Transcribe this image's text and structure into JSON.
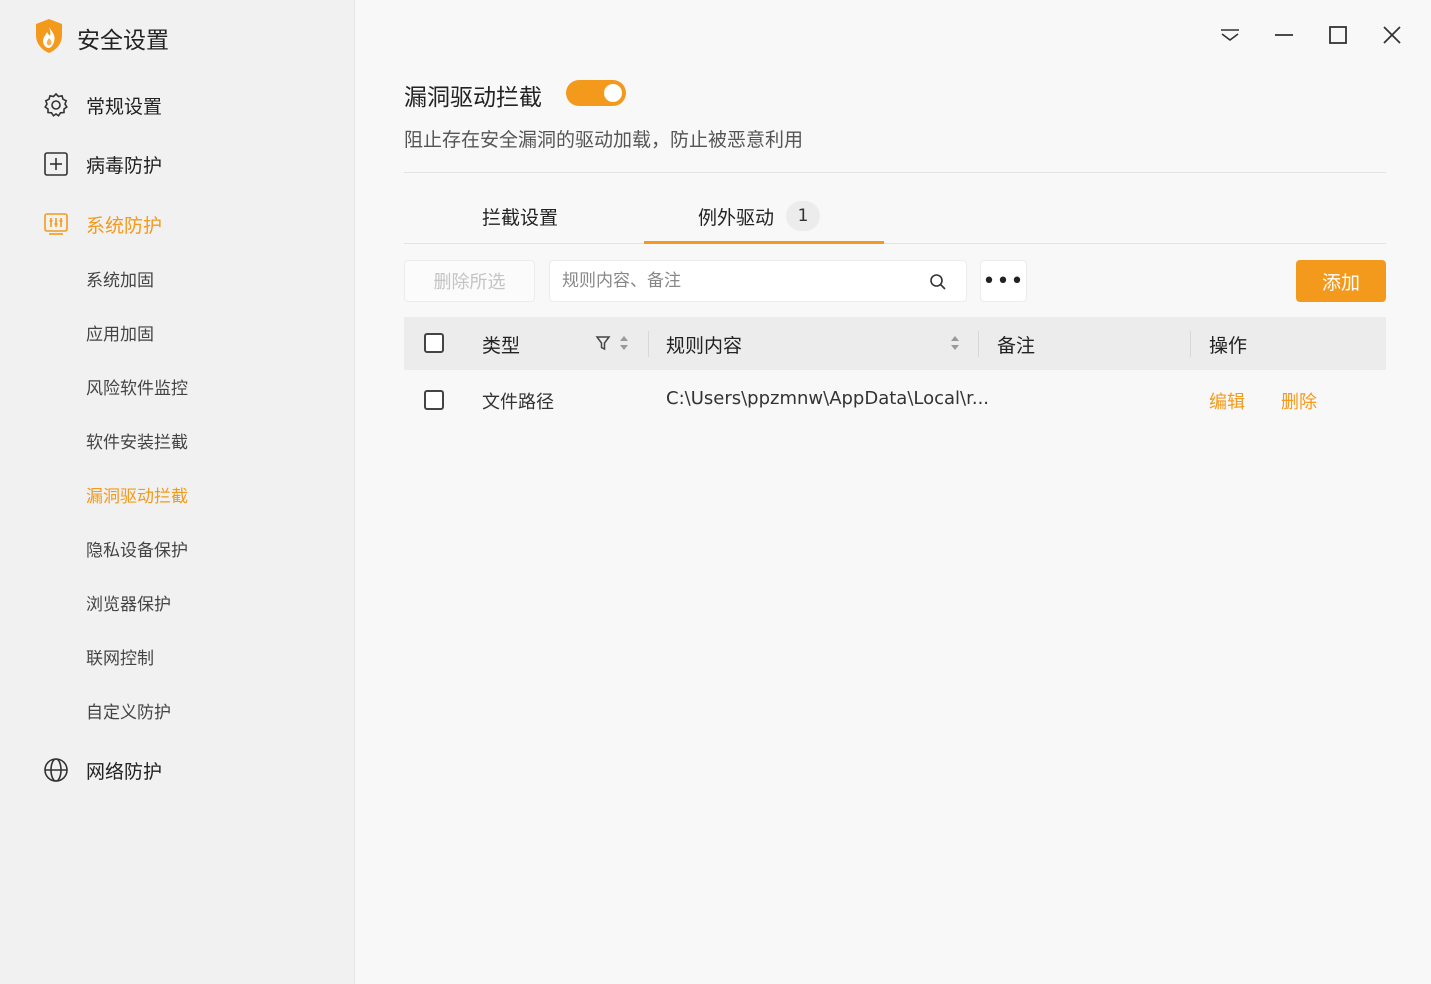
{
  "app": {
    "title": "安全设置",
    "logo_icon": "flame-shield-icon"
  },
  "window_controls": [
    "menu-icon",
    "minimize-icon",
    "maximize-icon",
    "close-icon"
  ],
  "sidebar": {
    "top_items": [
      {
        "label": "常规设置",
        "icon": "gear-icon"
      },
      {
        "label": "病毒防护",
        "icon": "plus-box-icon"
      },
      {
        "label": "系统防护",
        "icon": "system-sliders-icon",
        "active": true
      },
      {
        "label": "网络防护",
        "icon": "globe-icon"
      }
    ],
    "sub_items": [
      {
        "label": "系统加固"
      },
      {
        "label": "应用加固"
      },
      {
        "label": "风险软件监控"
      },
      {
        "label": "软件安装拦截"
      },
      {
        "label": "漏洞驱动拦截",
        "active": true
      },
      {
        "label": "隐私设备保护"
      },
      {
        "label": "浏览器保护"
      },
      {
        "label": "联网控制"
      },
      {
        "label": "自定义防护"
      }
    ]
  },
  "main": {
    "title": "漏洞驱动拦截",
    "toggle_on": true,
    "description": "阻止存在安全漏洞的驱动加载，防止被恶意利用",
    "tabs": [
      {
        "label": "拦截设置"
      },
      {
        "label": "例外驱动",
        "badge": "1",
        "active": true
      }
    ],
    "toolbar": {
      "delete_selected": "删除所选",
      "search_placeholder": "规则内容、备注",
      "more": "•••",
      "add": "添加"
    },
    "table": {
      "columns": [
        "类型",
        "规则内容",
        "备注",
        "操作"
      ],
      "rows": [
        {
          "type": "文件路径",
          "rule": "C:\\Users\\ppzmnw\\AppData\\Local\\r...",
          "note": "",
          "actions": [
            "编辑",
            "删除"
          ]
        }
      ]
    }
  },
  "colors": {
    "accent": "#f39a1c",
    "sidebar_bg": "#f1f1f1",
    "main_bg": "#f8f8f8"
  }
}
